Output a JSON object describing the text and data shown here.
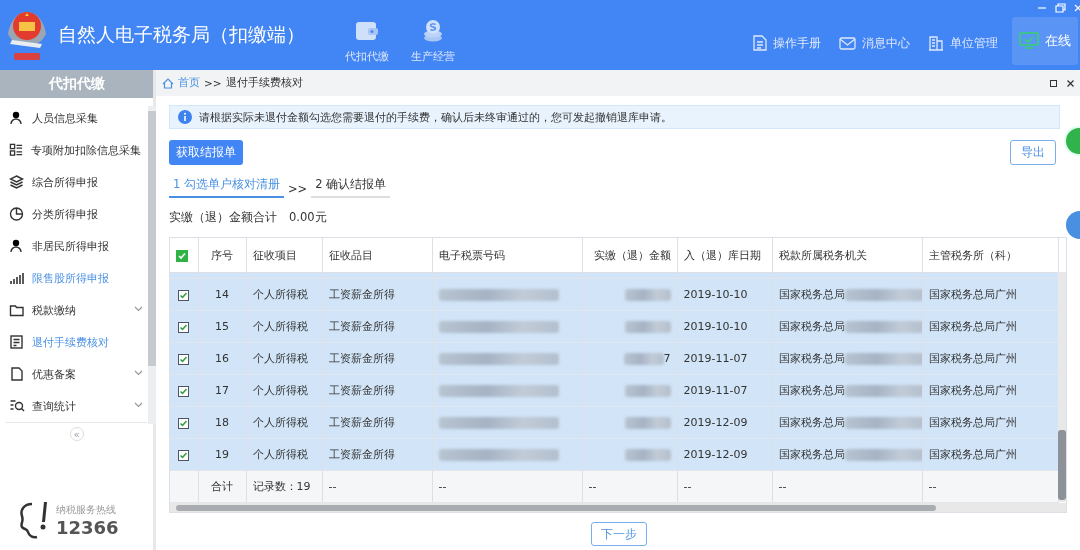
{
  "header": {
    "title": "自然人电子税务局（扣缴端）",
    "nav": [
      {
        "label": "代扣代缴",
        "kind": "wallet"
      },
      {
        "label": "生产经营",
        "kind": "coins"
      }
    ],
    "tools": [
      {
        "label": "操作手册",
        "kind": "doc"
      },
      {
        "label": "消息中心",
        "kind": "mail"
      },
      {
        "label": "单位管理",
        "kind": "building"
      }
    ],
    "status": {
      "label": "在线"
    }
  },
  "sidebar": {
    "title": "代扣代缴",
    "items": [
      {
        "label": "人员信息采集",
        "kind": "person",
        "highlighted": false,
        "expandable": false
      },
      {
        "label": "专项附加扣除信息采集",
        "kind": "list",
        "highlighted": false,
        "expandable": false
      },
      {
        "label": "综合所得申报",
        "kind": "layers",
        "highlighted": false,
        "expandable": false
      },
      {
        "label": "分类所得申报",
        "kind": "pie",
        "highlighted": false,
        "expandable": false
      },
      {
        "label": "非居民所得申报",
        "kind": "person",
        "highlighted": false,
        "expandable": false
      },
      {
        "label": "限售股所得申报",
        "kind": "bars",
        "highlighted": true,
        "expandable": false
      },
      {
        "label": "税款缴纳",
        "kind": "folder",
        "highlighted": false,
        "expandable": true
      },
      {
        "label": "退付手续费核对",
        "kind": "form",
        "highlighted": true,
        "expandable": false
      },
      {
        "label": "优惠备案",
        "kind": "page",
        "highlighted": false,
        "expandable": true
      },
      {
        "label": "查询统计",
        "kind": "search",
        "highlighted": false,
        "expandable": true
      }
    ],
    "collapse": "«",
    "hotline": {
      "label": "纳税服务热线",
      "number": "12366"
    }
  },
  "breadcrumb": {
    "home": "首页",
    "separator": ">>",
    "current": "退付手续费核对"
  },
  "notice": "请根据实际未退付金额勾选您需要退付的手续费，确认后未终审通过的，您可发起撤销退库申请。",
  "actions": {
    "fetch": "获取结报单",
    "export": "导出"
  },
  "steps": {
    "separator": ">>",
    "items": [
      {
        "label": "1 勾选单户核对清册",
        "selected": true
      },
      {
        "label": "2 确认结报单",
        "selected": false
      }
    ]
  },
  "total": {
    "label": "实缴（退）金额合计",
    "value": "0.00元"
  },
  "table": {
    "all_checked": true,
    "columns": [
      "序号",
      "征收项目",
      "征收品目",
      "电子税票号码",
      "实缴（退）金额",
      "入（退）库日期",
      "税款所属税务机关",
      "主管税务所（科）"
    ],
    "rows": [
      {
        "checked": true,
        "cells": [
          {
            "text": "14",
            "redacted": false
          },
          {
            "text": "个人所得税",
            "redacted": false
          },
          {
            "text": "工资薪金所得",
            "redacted": false
          },
          {
            "redacted": true
          },
          {
            "redacted": true
          },
          {
            "text": "2019-10-10",
            "redacted": false
          },
          {
            "text": "国家税务总局",
            "redacted": true
          },
          {
            "text": "国家税务总局广州",
            "redacted": false
          }
        ]
      },
      {
        "checked": true,
        "cells": [
          {
            "text": "15",
            "redacted": false
          },
          {
            "text": "个人所得税",
            "redacted": false
          },
          {
            "text": "工资薪金所得",
            "redacted": false
          },
          {
            "redacted": true
          },
          {
            "redacted": true
          },
          {
            "text": "2019-10-10",
            "redacted": false
          },
          {
            "text": "国家税务总局",
            "redacted": true
          },
          {
            "text": "国家税务总局广州",
            "redacted": false
          }
        ]
      },
      {
        "checked": true,
        "cells": [
          {
            "text": "16",
            "redacted": false
          },
          {
            "text": "个人所得税",
            "redacted": false
          },
          {
            "text": "工资薪金所得",
            "redacted": false
          },
          {
            "redacted": true
          },
          {
            "text": "7",
            "redacted": true
          },
          {
            "text": "2019-11-07",
            "redacted": false
          },
          {
            "text": "国家税务总局",
            "redacted": true
          },
          {
            "text": "国家税务总局广州",
            "redacted": false
          }
        ]
      },
      {
        "checked": true,
        "cells": [
          {
            "text": "17",
            "redacted": false
          },
          {
            "text": "个人所得税",
            "redacted": false
          },
          {
            "text": "工资薪金所得",
            "redacted": false
          },
          {
            "redacted": true
          },
          {
            "redacted": true
          },
          {
            "text": "2019-11-07",
            "redacted": false
          },
          {
            "text": "国家税务总局",
            "redacted": true
          },
          {
            "text": "国家税务总局广州",
            "redacted": false
          }
        ]
      },
      {
        "checked": true,
        "cells": [
          {
            "text": "18",
            "redacted": false
          },
          {
            "text": "个人所得税",
            "redacted": false
          },
          {
            "text": "工资薪金所得",
            "redacted": false
          },
          {
            "redacted": true
          },
          {
            "redacted": true
          },
          {
            "text": "2019-12-09",
            "redacted": false
          },
          {
            "text": "国家税务总局",
            "redacted": true
          },
          {
            "text": "国家税务总局广州",
            "redacted": false
          }
        ]
      },
      {
        "checked": true,
        "cells": [
          {
            "text": "19",
            "redacted": false
          },
          {
            "text": "个人所得税",
            "redacted": false
          },
          {
            "text": "工资薪金所得",
            "redacted": false
          },
          {
            "redacted": true
          },
          {
            "redacted": true
          },
          {
            "text": "2019-12-09",
            "redacted": false
          },
          {
            "text": "国家税务总局",
            "redacted": true
          },
          {
            "text": "国家税务总局广州",
            "redacted": false
          }
        ]
      }
    ],
    "footer": [
      "合计",
      "记录数：19",
      "--",
      "--",
      "--",
      "--",
      "--",
      "--"
    ]
  },
  "next": "下一步"
}
